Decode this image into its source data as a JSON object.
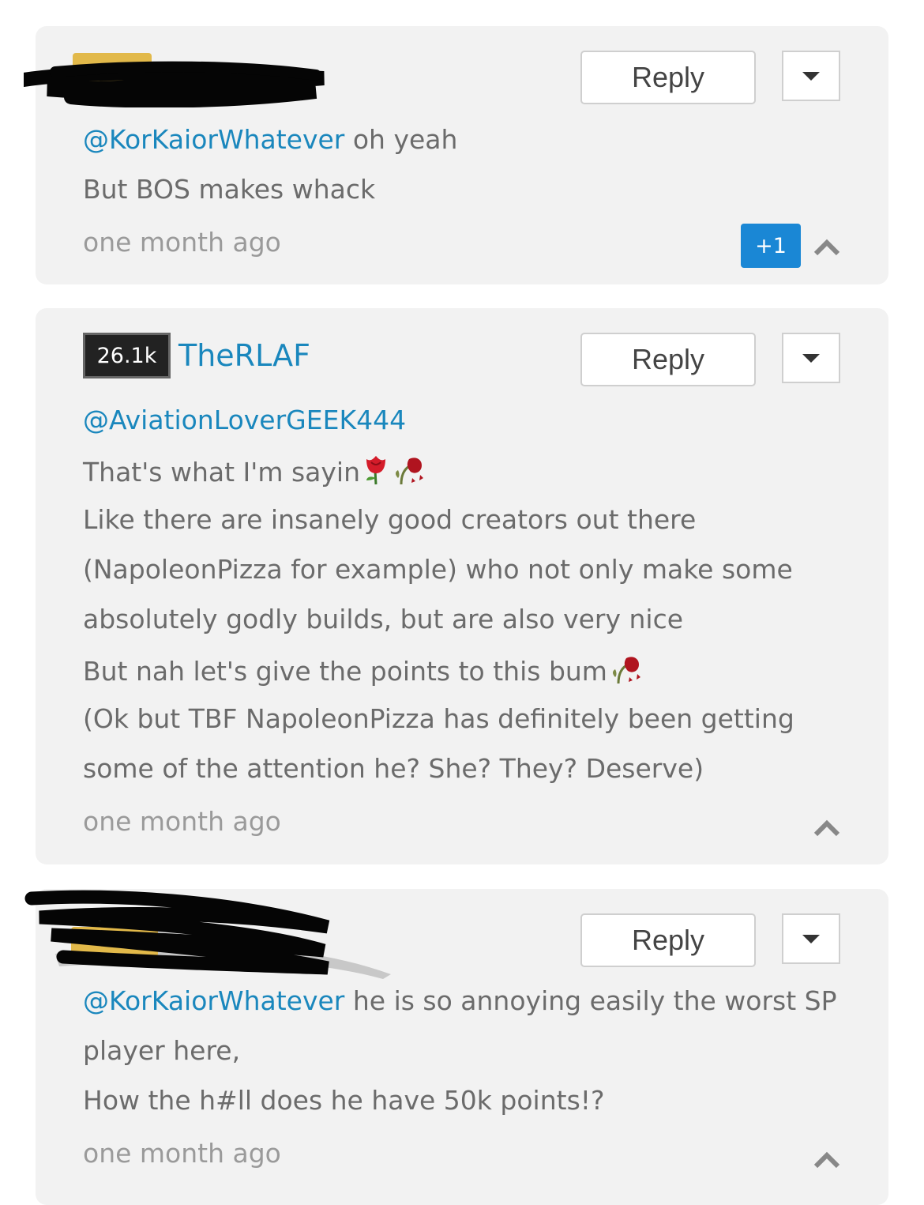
{
  "colors": {
    "mention": "#1a87bd",
    "upvote_count_bg": "#1a87d5",
    "card_bg": "#f2f2f2",
    "text": "#6b6b6b",
    "timestamp": "#9a9a9a"
  },
  "comments": [
    {
      "reply_label": "Reply",
      "username_redacted": true,
      "mention": "@KorKaiorWhatever",
      "line1_rest": " oh yeah",
      "line2": "But BOS makes whack",
      "timestamp": "one month ago",
      "upvote_count": "+1"
    },
    {
      "reply_label": "Reply",
      "badge": "26.1k",
      "username": "TheRLAF",
      "mention": "@AviationLoverGEEK444",
      "lines": [
        "That's what I'm sayin",
        "Like there are insanely good creators out there",
        "(NapoleonPizza for example) who not only make some",
        "absolutely godly builds, but are also very nice",
        "But nah let's give the points to this bum",
        "(Ok but TBF NapoleonPizza has definitely been getting",
        "some of the attention he? She? They? Deserve)"
      ],
      "emojis": [
        "rose",
        "wilted-rose"
      ],
      "timestamp": "one month ago"
    },
    {
      "reply_label": "Reply",
      "username_redacted": true,
      "mention": "@KorKaiorWhatever",
      "line1_rest": " he is so annoying easily the worst SP",
      "line2": "player here,",
      "line3": "How the h#ll does he have 50k points!?",
      "timestamp": "one month ago"
    }
  ]
}
